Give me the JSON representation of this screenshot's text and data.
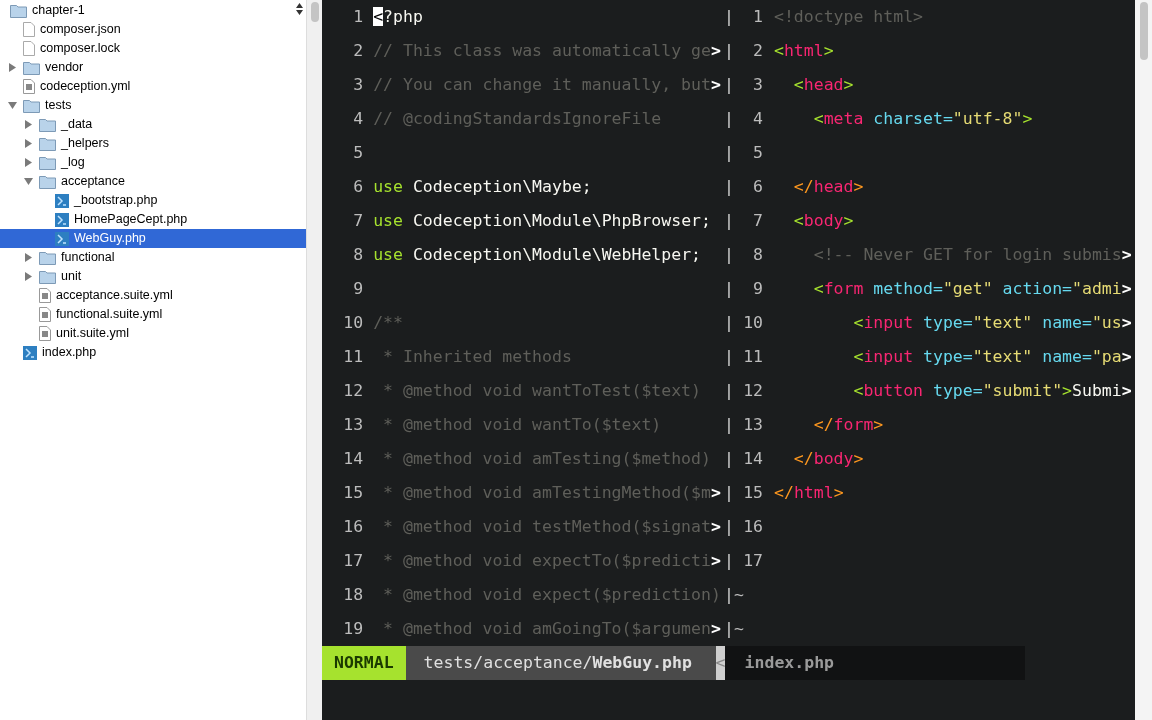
{
  "sidebar": {
    "tree": [
      {
        "name": "chapter-1",
        "kind": "folder",
        "children": [
          {
            "name": "composer.json",
            "kind": "file"
          },
          {
            "name": "composer.lock",
            "kind": "file"
          },
          {
            "name": "vendor",
            "kind": "folder",
            "expanded": false
          },
          {
            "name": "codeception.yml",
            "kind": "yml"
          },
          {
            "name": "tests",
            "kind": "folder",
            "expanded": true,
            "children": [
              {
                "name": "_data",
                "kind": "folder",
                "expanded": false
              },
              {
                "name": "_helpers",
                "kind": "folder",
                "expanded": false
              },
              {
                "name": "_log",
                "kind": "folder",
                "expanded": false
              },
              {
                "name": "acceptance",
                "kind": "folder",
                "expanded": true,
                "children": [
                  {
                    "name": "_bootstrap.php",
                    "kind": "php",
                    "selected": false
                  },
                  {
                    "name": "HomePageCept.php",
                    "kind": "php",
                    "selected": false
                  },
                  {
                    "name": "WebGuy.php",
                    "kind": "php",
                    "selected": true
                  }
                ]
              },
              {
                "name": "functional",
                "kind": "folder",
                "expanded": false
              },
              {
                "name": "unit",
                "kind": "folder",
                "expanded": false
              },
              {
                "name": "acceptance.suite.yml",
                "kind": "yml"
              },
              {
                "name": "functional.suite.yml",
                "kind": "yml"
              },
              {
                "name": "unit.suite.yml",
                "kind": "yml"
              }
            ]
          },
          {
            "name": "index.php",
            "kind": "php",
            "selected": false
          }
        ]
      }
    ]
  },
  "left_pane": {
    "lines": [
      {
        "number": "1",
        "tokens": [
          {
            "kind": "cursor",
            "text": "<"
          },
          {
            "kind": "plain",
            "text": "?php"
          }
        ],
        "split": "|"
      },
      {
        "number": "2",
        "tokens": [
          {
            "kind": "comment",
            "text": "// This class was automatically ge"
          },
          {
            "kind": "more",
            "text": ">"
          }
        ],
        "split": "|"
      },
      {
        "number": "3",
        "tokens": [
          {
            "kind": "comment",
            "text": "// You can change it manually, but"
          },
          {
            "kind": "more",
            "text": ">"
          }
        ],
        "split": "|"
      },
      {
        "number": "4",
        "tokens": [
          {
            "kind": "comment",
            "text": "// @codingStandardsIgnoreFile"
          }
        ],
        "split": "|"
      },
      {
        "number": "5",
        "split": "|"
      },
      {
        "number": "6",
        "tokens": [
          {
            "kind": "keyword",
            "text": "use"
          },
          {
            "kind": "plain",
            "text": " Codeception\\Maybe;"
          }
        ],
        "split": "|"
      },
      {
        "number": "7",
        "tokens": [
          {
            "kind": "keyword",
            "text": "use"
          },
          {
            "kind": "plain",
            "text": " Codeception\\Module\\PhpBrowser;"
          }
        ],
        "split": "|"
      },
      {
        "number": "8",
        "tokens": [
          {
            "kind": "keyword",
            "text": "use"
          },
          {
            "kind": "plain",
            "text": " Codeception\\Module\\WebHelper;"
          }
        ],
        "split": "|"
      },
      {
        "number": "9",
        "split": "|"
      },
      {
        "number": "10",
        "tokens": [
          {
            "kind": "comment",
            "text": "/**"
          }
        ],
        "split": "|"
      },
      {
        "number": "11",
        "tokens": [
          {
            "kind": "comment",
            "text": " * Inherited methods"
          }
        ],
        "split": "|"
      },
      {
        "number": "12",
        "tokens": [
          {
            "kind": "comment",
            "text": " * @method void wantToTest($text)"
          }
        ],
        "split": "|"
      },
      {
        "number": "13",
        "tokens": [
          {
            "kind": "comment",
            "text": " * @method void wantTo($text)"
          }
        ],
        "split": "|"
      },
      {
        "number": "14",
        "tokens": [
          {
            "kind": "comment",
            "text": " * @method void amTesting($method)"
          }
        ],
        "split": "|"
      },
      {
        "number": "15",
        "tokens": [
          {
            "kind": "comment",
            "text": " * @method void amTestingMethod($m"
          },
          {
            "kind": "more",
            "text": ">"
          }
        ],
        "split": "|"
      },
      {
        "number": "16",
        "tokens": [
          {
            "kind": "comment",
            "text": " * @method void testMethod($signat"
          },
          {
            "kind": "more",
            "text": ">"
          }
        ],
        "split": "|"
      },
      {
        "number": "17",
        "tokens": [
          {
            "kind": "comment",
            "text": " * @method void expectTo($predicti"
          },
          {
            "kind": "more",
            "text": ">"
          }
        ],
        "split": "|"
      },
      {
        "number": "18",
        "tokens": [
          {
            "kind": "comment",
            "text": " * @method void expect($prediction)"
          }
        ],
        "split": "|"
      },
      {
        "number": "19",
        "tokens": [
          {
            "kind": "comment",
            "text": " * @method void amGoingTo($argumen"
          },
          {
            "kind": "more",
            "text": ">"
          }
        ],
        "split": "|"
      }
    ]
  },
  "right_pane": {
    "lines": [
      {
        "number": "1",
        "tokens": [
          {
            "kind": "comment",
            "text": "<!doctype html>"
          }
        ]
      },
      {
        "number": "2",
        "tokens": [
          {
            "kind": "open",
            "text": "<"
          },
          {
            "kind": "tag",
            "text": "html"
          },
          {
            "kind": "open",
            "text": ">"
          }
        ]
      },
      {
        "number": "3",
        "tokens": [
          {
            "kind": "open",
            "text": "  <"
          },
          {
            "kind": "tag",
            "text": "head"
          },
          {
            "kind": "open",
            "text": ">"
          }
        ]
      },
      {
        "number": "4",
        "tokens": [
          {
            "kind": "open",
            "text": "    <"
          },
          {
            "kind": "tag",
            "text": "meta"
          },
          {
            "kind": "attr",
            "text": " charset="
          },
          {
            "kind": "string",
            "text": "\"utf-8\""
          },
          {
            "kind": "open",
            "text": ">"
          }
        ]
      },
      {
        "number": "5"
      },
      {
        "number": "6",
        "tokens": [
          {
            "kind": "close",
            "text": "  </"
          },
          {
            "kind": "tag",
            "text": "head"
          },
          {
            "kind": "close",
            "text": ">"
          }
        ]
      },
      {
        "number": "7",
        "tokens": [
          {
            "kind": "open",
            "text": "  <"
          },
          {
            "kind": "tag",
            "text": "body"
          },
          {
            "kind": "open",
            "text": ">"
          }
        ]
      },
      {
        "number": "8",
        "tokens": [
          {
            "kind": "comment",
            "text": "    <!-- Never GET for login submis"
          },
          {
            "kind": "more",
            "text": ">"
          }
        ]
      },
      {
        "number": "9",
        "tokens": [
          {
            "kind": "open",
            "text": "    <"
          },
          {
            "kind": "tag",
            "text": "form"
          },
          {
            "kind": "attr",
            "text": " method="
          },
          {
            "kind": "string",
            "text": "\"get\""
          },
          {
            "kind": "attr",
            "text": " action="
          },
          {
            "kind": "string",
            "text": "\"admi"
          },
          {
            "kind": "more",
            "text": ">"
          }
        ]
      },
      {
        "number": "10",
        "tokens": [
          {
            "kind": "open",
            "text": "        <"
          },
          {
            "kind": "tag",
            "text": "input"
          },
          {
            "kind": "attr",
            "text": " type="
          },
          {
            "kind": "string",
            "text": "\"text\""
          },
          {
            "kind": "attr",
            "text": " name="
          },
          {
            "kind": "string",
            "text": "\"us"
          },
          {
            "kind": "more",
            "text": ">"
          }
        ]
      },
      {
        "number": "11",
        "tokens": [
          {
            "kind": "open",
            "text": "        <"
          },
          {
            "kind": "tag",
            "text": "input"
          },
          {
            "kind": "attr",
            "text": " type="
          },
          {
            "kind": "string",
            "text": "\"text\""
          },
          {
            "kind": "attr",
            "text": " name="
          },
          {
            "kind": "string",
            "text": "\"pa"
          },
          {
            "kind": "more",
            "text": ">"
          }
        ]
      },
      {
        "number": "12",
        "tokens": [
          {
            "kind": "open",
            "text": "        <"
          },
          {
            "kind": "tag",
            "text": "button"
          },
          {
            "kind": "attr",
            "text": " type="
          },
          {
            "kind": "string",
            "text": "\"submit\""
          },
          {
            "kind": "open",
            "text": ">"
          },
          {
            "kind": "plain",
            "text": "Submi"
          },
          {
            "kind": "more",
            "text": ">"
          }
        ]
      },
      {
        "number": "13",
        "tokens": [
          {
            "kind": "close",
            "text": "    </"
          },
          {
            "kind": "tag",
            "text": "form"
          },
          {
            "kind": "close",
            "text": ">"
          }
        ]
      },
      {
        "number": "14",
        "tokens": [
          {
            "kind": "close",
            "text": "  </"
          },
          {
            "kind": "tag",
            "text": "body"
          },
          {
            "kind": "close",
            "text": ">"
          }
        ]
      },
      {
        "number": "15",
        "tokens": [
          {
            "kind": "close",
            "text": "</"
          },
          {
            "kind": "tag",
            "text": "html"
          },
          {
            "kind": "close",
            "text": ">"
          }
        ]
      },
      {
        "number": "16"
      },
      {
        "number": "17"
      }
    ],
    "tildes": [
      "~",
      "~"
    ]
  },
  "status_bar": {
    "mode": "NORMAL",
    "path": "tests/acceptance/**WebGuy.php**",
    "separator": "<",
    "other_file": "index.php"
  }
}
